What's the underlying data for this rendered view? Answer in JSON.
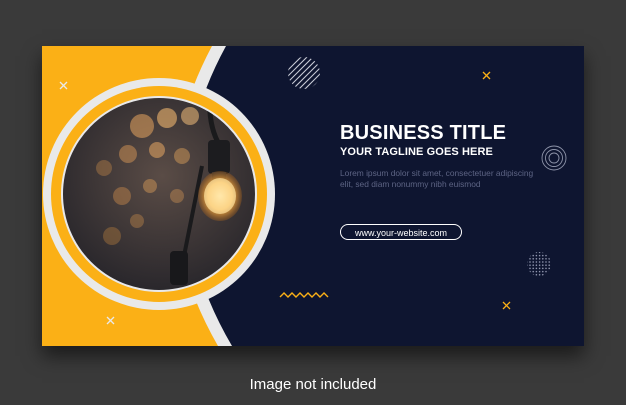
{
  "banner": {
    "title": "BUSINESS TITLE",
    "tagline": "YOUR TAGLINE GOES HERE",
    "body": "Lorem ipsum dolor sit amet, consectetuer adipiscing elit, sed diam nonummy nibh euismod",
    "website": "www.your-website.com"
  },
  "footer": {
    "note": "Image not included"
  },
  "colors": {
    "accent": "#fbb016",
    "navy": "#0e1530",
    "page": "#3a3a3a",
    "ring": "#e9e9e9"
  },
  "icons": [
    "x-mark-icon",
    "striped-circle-icon",
    "concentric-circles-icon",
    "dotted-circle-icon",
    "zigzag-icon",
    "light-bulb-photo"
  ]
}
